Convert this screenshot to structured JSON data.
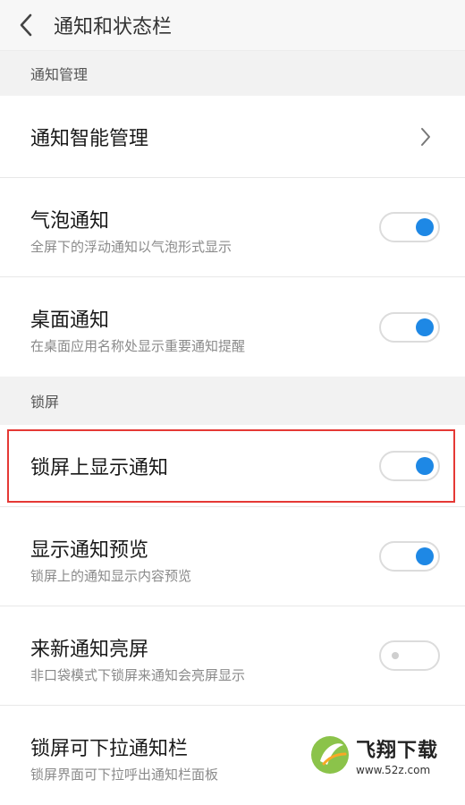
{
  "header": {
    "title": "通知和状态栏"
  },
  "sections": {
    "notification": {
      "label": "通知管理"
    },
    "lockscreen": {
      "label": "锁屏"
    }
  },
  "items": {
    "smart": {
      "title": "通知智能管理"
    },
    "bubble": {
      "title": "气泡通知",
      "subtitle": "全屏下的浮动通知以气泡形式显示",
      "enabled": true
    },
    "desktop": {
      "title": "桌面通知",
      "subtitle": "在桌面应用名称处显示重要通知提醒",
      "enabled": true
    },
    "lock_show": {
      "title": "锁屏上显示通知",
      "enabled": true
    },
    "preview": {
      "title": "显示通知预览",
      "subtitle": "锁屏上的通知显示内容预览",
      "enabled": true
    },
    "wake": {
      "title": "来新通知亮屏",
      "subtitle": "非口袋模式下锁屏来通知会亮屏显示",
      "enabled": false
    },
    "pulldown": {
      "title": "锁屏可下拉通知栏",
      "subtitle": "锁屏界面可下拉呼出通知栏面板"
    }
  },
  "watermark": {
    "brand": "飞翔下载",
    "url": "www.52z.com"
  },
  "colors": {
    "accent": "#1e88e5",
    "highlight": "#e53935"
  }
}
